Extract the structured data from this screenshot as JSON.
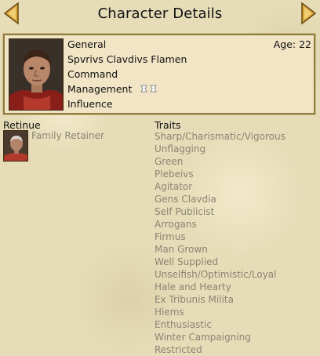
{
  "header": {
    "title": "Character Details"
  },
  "character": {
    "rank": "General",
    "age_label": "Age: 22",
    "name": "Spvrivs Clavdivs Flamen",
    "attributes": [
      "Command",
      "Management",
      "Influence"
    ]
  },
  "retinue": {
    "label": "Retinue",
    "items": [
      {
        "name": "Family Retainer"
      }
    ]
  },
  "traits": {
    "label": "Traits",
    "items": [
      "Sharp/Charismatic/Vigorous",
      "Unflagging",
      "Green",
      "Plebeivs",
      "Agitator",
      "Gens Clavdia",
      "Self Publicist",
      "Arrogans",
      "Firmus",
      "Man Grown",
      "Well Supplied",
      "Unselfish/Optimistic/Loyal",
      "Hale and Hearty",
      "Ex Tribunis Milita",
      "Hiems",
      "Enthusiastic",
      "Winter Campaigning",
      "Restricted"
    ]
  },
  "colors": {
    "parchment": "#e6dcb8",
    "panel": "#f1e5c6",
    "border": "#8d7a3e",
    "muted_text": "#8a8572",
    "arrow_fill": "#d9a63a"
  }
}
